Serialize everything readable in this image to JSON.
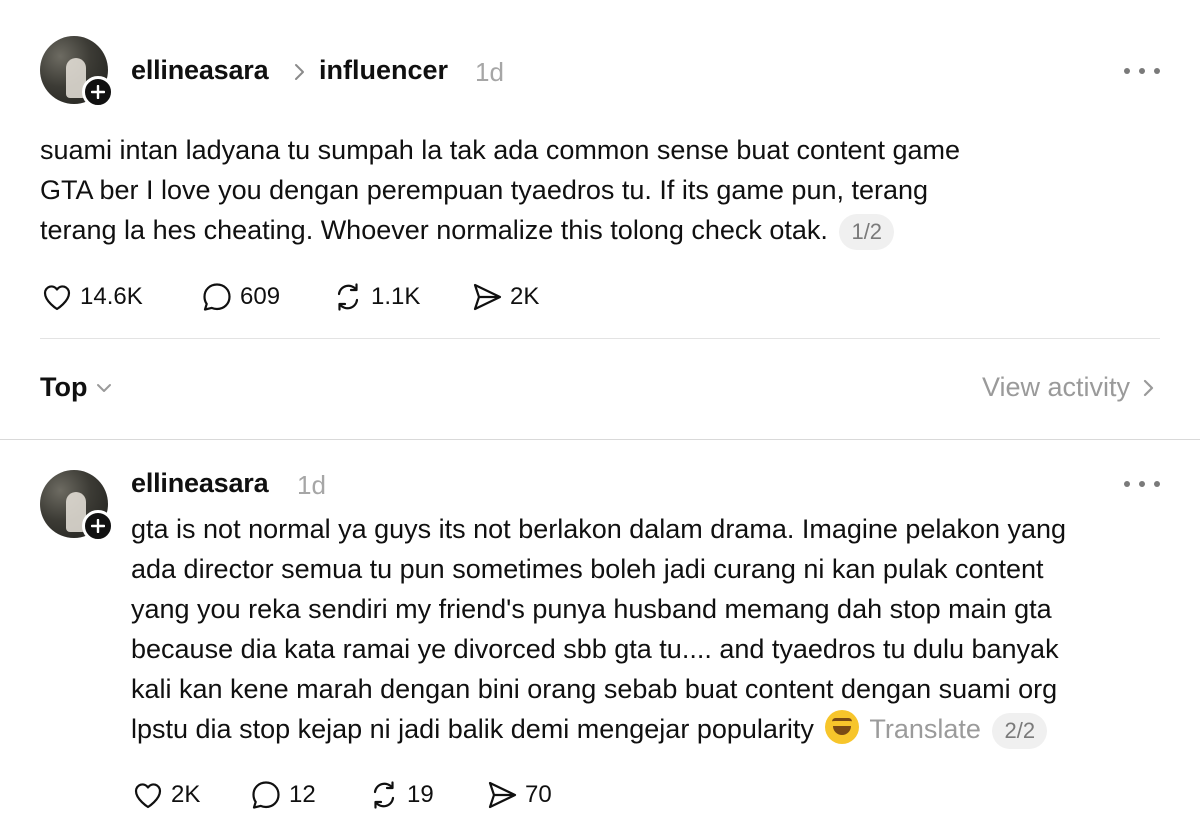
{
  "post": {
    "username": "ellineasara",
    "topic": "influencer",
    "time": "1d",
    "lines": [
      "suami intan ladyana tu sumpah la tak ada common sense buat content game",
      "GTA ber I love you dengan perempuan tyaedros tu. If its game pun, terang",
      "terang la hes cheating. Whoever normalize this tolong check otak."
    ],
    "thread_index": "1/2",
    "likes": "14.6K",
    "replies": "609",
    "reposts": "1.1K",
    "shares": "2K"
  },
  "sort": {
    "label": "Top",
    "view_activity": "View activity"
  },
  "reply": {
    "username": "ellineasara",
    "time": "1d",
    "lines": [
      "gta is not normal ya guys its not berlakon dalam drama. Imagine pelakon yang",
      "ada director semua tu pun sometimes boleh jadi curang ni kan pulak content",
      "yang you reka sendiri my friend's punya husband memang dah stop main gta",
      "because dia kata ramai ye divorced sbb gta tu.... and tyaedros tu dulu banyak",
      "kali kan kene marah dengan bini orang sebab buat content dengan suami org",
      "lpstu dia stop kejap ni jadi balik demi mengejar popularity"
    ],
    "emoji": "rolling-on-floor-laughing",
    "translate": "Translate",
    "thread_index": "2/2",
    "likes": "2K",
    "replies": "12",
    "reposts": "19",
    "shares": "70"
  }
}
